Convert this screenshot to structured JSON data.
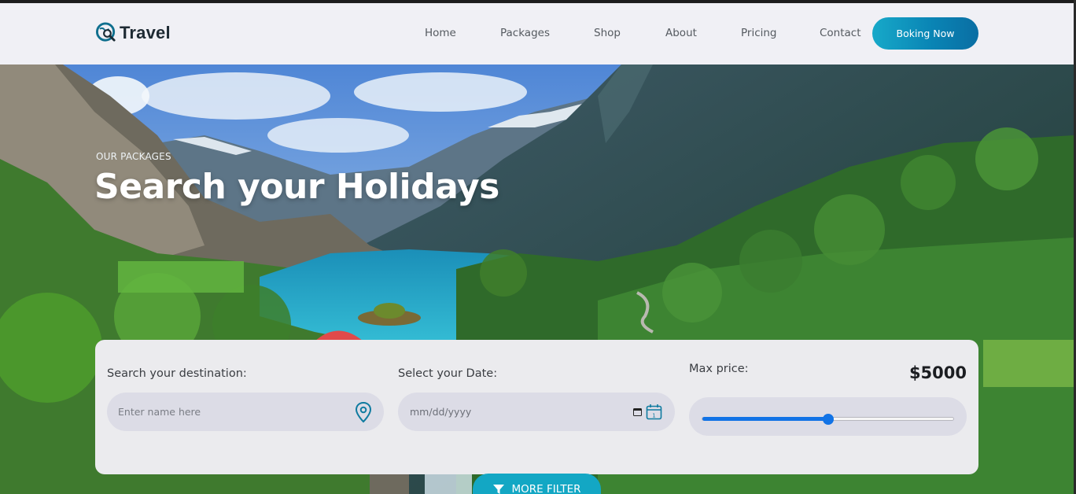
{
  "brand": {
    "name": "Travel"
  },
  "nav": {
    "items": [
      "Home",
      "Packages",
      "Shop",
      "About",
      "Pricing",
      "Contact"
    ],
    "cta": "Boking Now"
  },
  "hero": {
    "eyebrow": "OUR PACKAGES",
    "title": "Search your Holidays"
  },
  "search": {
    "destination": {
      "label": "Search your destination:",
      "placeholder": "Enter name here"
    },
    "date": {
      "label": "Select your Date:",
      "value": "mm/dd/yyyy"
    },
    "price": {
      "label": "Max price:",
      "value": "$5000",
      "slider_fraction": 0.5
    },
    "more_filter": "MORE FILTER"
  },
  "colors": {
    "accent": "#13a7c4",
    "cta_gradient_start": "#17a9c9",
    "cta_gradient_end": "#0a6ea3",
    "slider": "#1273e6"
  },
  "icons": {
    "logo": "map-search-icon",
    "destination": "location-pin-icon",
    "date": "calendar-icon",
    "filter": "funnel-icon"
  }
}
